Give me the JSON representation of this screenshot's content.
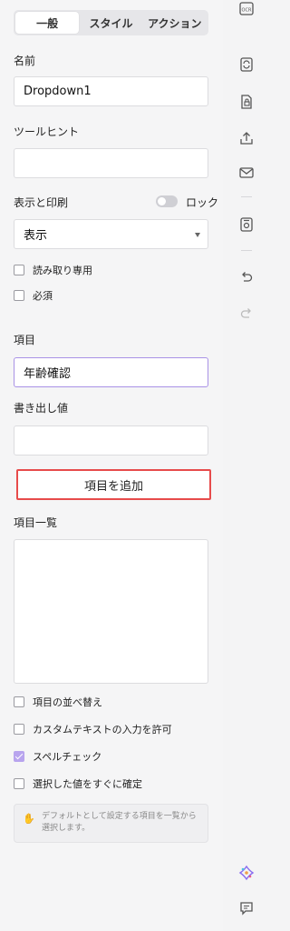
{
  "tabs": [
    {
      "label": "一般",
      "active": true
    },
    {
      "label": "スタイル",
      "active": false
    },
    {
      "label": "アクション",
      "active": false
    }
  ],
  "name": {
    "label": "名前",
    "value": "Dropdown1"
  },
  "tooltip": {
    "label": "ツールヒント",
    "value": ""
  },
  "display_print": {
    "label": "表示と印刷",
    "lock_label": "ロック",
    "lock_on": false,
    "selected": "表示"
  },
  "checkboxes_top": [
    {
      "label": "読み取り専用",
      "checked": false
    },
    {
      "label": "必須",
      "checked": false
    }
  ],
  "item": {
    "label": "項目",
    "value": "年齢確認"
  },
  "export_value": {
    "label": "書き出し値",
    "value": ""
  },
  "add_button": {
    "label": "項目を追加"
  },
  "item_list": {
    "label": "項目一覧",
    "items": []
  },
  "checkboxes_bottom": [
    {
      "label": "項目の並べ替え",
      "checked": false
    },
    {
      "label": "カスタムテキストの入力を許可",
      "checked": false
    },
    {
      "label": "スペルチェック",
      "checked": true
    },
    {
      "label": "選択した値をすぐに確定",
      "checked": false
    }
  ],
  "hint": {
    "text": "デフォルトとして設定する項目を一覧から選択します。"
  },
  "accent_color": "#b8a4ee",
  "highlight_color": "#e74b4b",
  "rail_icons": [
    "ocr-icon",
    "convert-icon",
    "protect-file-icon",
    "share-icon",
    "email-icon",
    "save-icon",
    "undo-icon",
    "redo-icon",
    "ai-assistant-icon",
    "comment-icon"
  ]
}
